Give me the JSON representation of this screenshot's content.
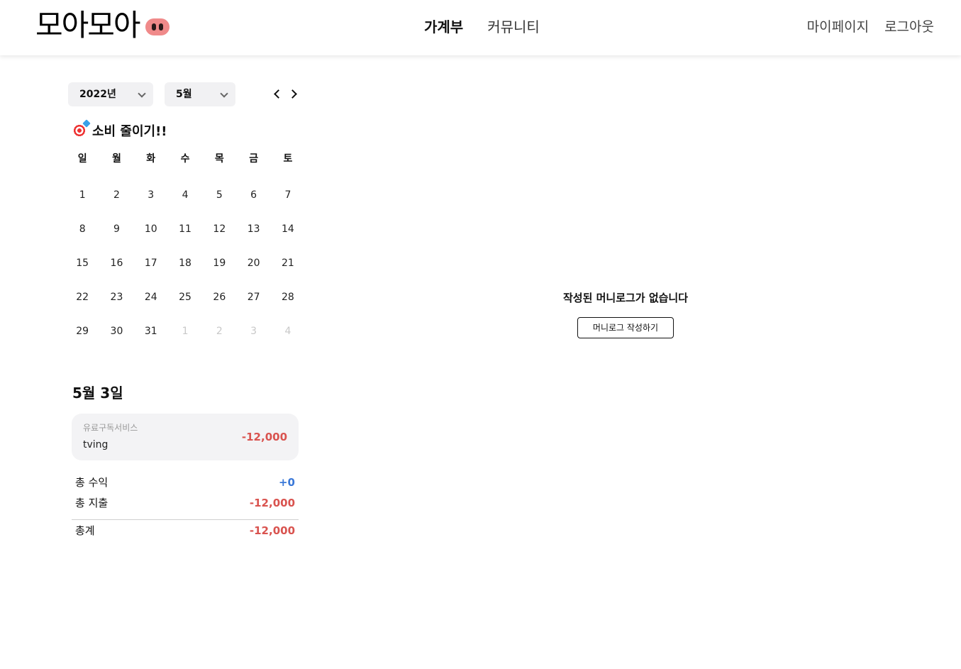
{
  "header": {
    "logo_text": "모아모아",
    "nav": {
      "ledger": "가계부",
      "community": "커뮤니티"
    },
    "mypage": "마이페이지",
    "logout": "로그아웃"
  },
  "filters": {
    "year": "2022년",
    "month": "5월"
  },
  "goal": {
    "icon": "target-icon",
    "text": "소비 줄이기!!"
  },
  "calendar": {
    "weekdays": [
      "일",
      "월",
      "화",
      "수",
      "목",
      "금",
      "토"
    ],
    "weeks": [
      [
        "1",
        "2",
        "3",
        "4",
        "5",
        "6",
        "7"
      ],
      [
        "8",
        "9",
        "10",
        "11",
        "12",
        "13",
        "14"
      ],
      [
        "15",
        "16",
        "17",
        "18",
        "19",
        "20",
        "21"
      ],
      [
        "22",
        "23",
        "24",
        "25",
        "26",
        "27",
        "28"
      ],
      [
        "29",
        "30",
        "31",
        "1",
        "2",
        "3",
        "4"
      ]
    ]
  },
  "day": {
    "title": "5월 3일",
    "entries": [
      {
        "category": "유료구독서비스",
        "name": "tving",
        "amount": "-12,000"
      }
    ],
    "summary": {
      "income_label": "총 수익",
      "income_value": "+0",
      "expense_label": "총 지출",
      "expense_value": "-12,000",
      "total_label": "총계",
      "total_value": "-12,000"
    }
  },
  "moneylog": {
    "empty_text": "작성된 머니로그가 없습니다",
    "write_button": "머니로그 작성하기"
  },
  "colors": {
    "nose": "#f08a8a",
    "income": "#3a78d8",
    "expense": "#d9534f"
  }
}
